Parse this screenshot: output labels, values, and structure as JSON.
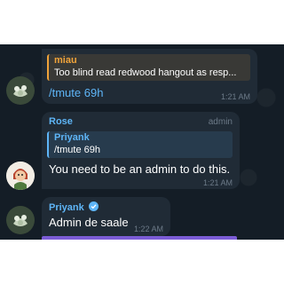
{
  "colors": {
    "background": "#141d26",
    "bubble": "#202b36",
    "miau_accent": "#f0a33a",
    "blue_accent": "#5eb5f7",
    "timestamp": "#6c7a88"
  },
  "messages": [
    {
      "reply_to": {
        "name": "miau",
        "text": "Too blind read redwood hangout as resp..."
      },
      "text": "/tmute 69h",
      "time": "1:21 AM"
    },
    {
      "sender": "Rose",
      "role": "admin",
      "reply_to": {
        "name": "Priyank",
        "text": "/tmute 69h"
      },
      "text": "You need to be an admin to do this.",
      "time": "1:21 AM"
    },
    {
      "sender": "Priyank",
      "sender_icon": "verified-badge-icon",
      "text": "Admin de saale",
      "time": "1:22 AM"
    }
  ]
}
